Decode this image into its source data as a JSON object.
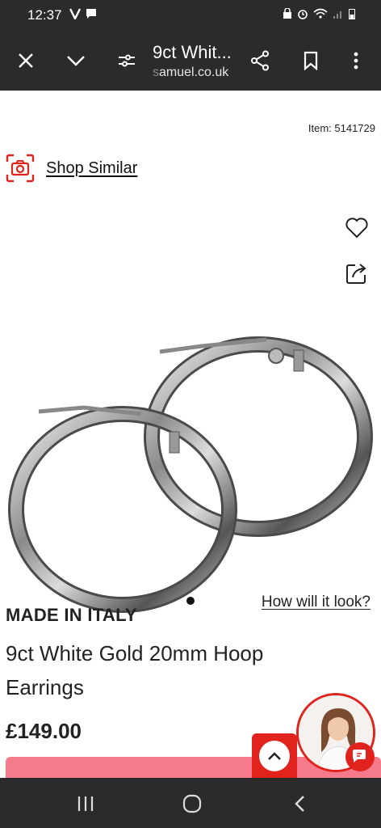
{
  "status_bar": {
    "time": "12:37"
  },
  "toolbar": {
    "page_title": "9ct Whit...",
    "url_prefix": "s",
    "url_domain": "amuel.co.uk"
  },
  "product": {
    "item_number": "Item: 5141729",
    "shop_similar": "Shop Similar",
    "how_will_it_look": "How will it look?",
    "made_in": "MADE IN ITALY",
    "title": "9ct White Gold 20mm Hoop Earrings",
    "price": "£149.00"
  },
  "colors": {
    "accent_red": "#e0231c",
    "button_pink": "#f47a8c",
    "chrome": "#2b2b2b"
  },
  "icons": [
    "close-icon",
    "chevron-down-icon",
    "page-settings-icon",
    "share-icon",
    "bookmark-icon",
    "more-vert-icon",
    "camera-icon",
    "heart-icon",
    "share-out-icon",
    "chevron-up-icon",
    "chat-icon",
    "recents-icon",
    "home-icon",
    "back-icon"
  ]
}
